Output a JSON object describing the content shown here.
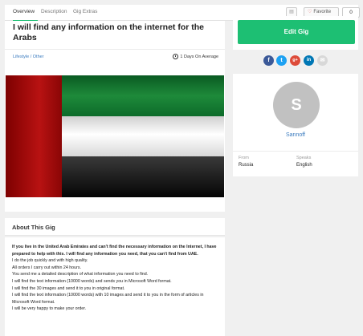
{
  "tabs": {
    "items": [
      "Overview",
      "Description",
      "Gig Extras"
    ],
    "active": "Overview",
    "favorite_label": "Favorite",
    "favorite_count": "0",
    "more_icon": "grid-icon"
  },
  "gig": {
    "title": "I will find any information on the internet for the Arabs",
    "category": "Lifestyle / Other",
    "delivery": "1 Days On Average",
    "image_description_colors": {
      "red": "#b81212",
      "green": "#1e8a3a",
      "white": "#ffffff",
      "black": "#1a1a1a"
    }
  },
  "about": {
    "heading": "About This Gig",
    "paragraphs": [
      {
        "text": "If you live in the United Arab Emirates and can't find the necessary information on the Internet, I have prepared to help with this. I will find any information you need, that you can't find from UAE.",
        "bold": true
      },
      {
        "text": "I do the job quickly and with high quality.",
        "bold": false
      },
      {
        "text": "All orders I carry out within 24 hours.",
        "bold": false
      },
      {
        "text": "You send me a detailed description of what information you need to find.",
        "bold": false
      },
      {
        "text": "I will find the text information (10000 words) and sends you in Microsoft Word format.",
        "bold": false
      },
      {
        "text": "I will find the 30 images and send it to you in original format.",
        "bold": false
      },
      {
        "text": "I will find the text information (10000 words) with 10 images and send it to you in the form of articles in Microsoft Word format.",
        "bold": false
      },
      {
        "text": "I will be very happy to make your order.",
        "bold": false
      }
    ]
  },
  "sidebar": {
    "edit_label": "Edit Gig",
    "share": [
      {
        "icon": "facebook-icon",
        "glyph": "f",
        "color": "#3b5998"
      },
      {
        "icon": "twitter-icon",
        "glyph": "t",
        "color": "#1da1f2"
      },
      {
        "icon": "google-plus-icon",
        "glyph": "g+",
        "color": "#dd4b39"
      },
      {
        "icon": "linkedin-icon",
        "glyph": "in",
        "color": "#0077b5"
      },
      {
        "icon": "email-icon",
        "glyph": "✉",
        "color": "#d8d8d8"
      }
    ],
    "profile": {
      "avatar_letter": "S",
      "username": "Sannoff",
      "from_label": "From",
      "from_value": "Russia",
      "speaks_label": "Speaks",
      "speaks_value": "English"
    }
  },
  "colors": {
    "accent": "#1dbf73",
    "link": "#3a7bbf"
  }
}
